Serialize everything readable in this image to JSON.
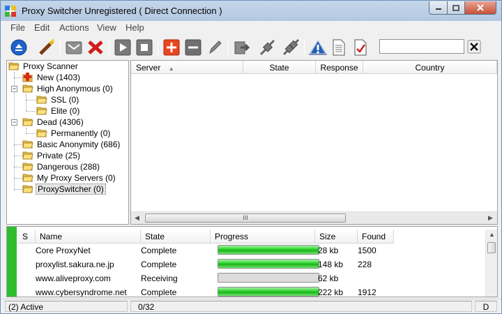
{
  "window": {
    "title": "Proxy Switcher Unregistered ( Direct Connection )"
  },
  "menu": [
    "File",
    "Edit",
    "Actions",
    "View",
    "Help"
  ],
  "toolbar": {
    "buttons": [
      "eject-icon",
      "wand-icon",
      "mail-icon",
      "delete-icon",
      "play-icon",
      "stop-icon",
      "add-icon",
      "remove-icon",
      "edit-icon",
      "export-icon",
      "connect-icon",
      "disconnect-icon",
      "warning-icon",
      "document-icon",
      "checklist-icon"
    ],
    "search_value": "",
    "clear_label": "✕"
  },
  "tree": [
    {
      "label": "Proxy Scanner",
      "level": 0
    },
    {
      "label": "New (1403)",
      "level": 1
    },
    {
      "label": "High Anonymous (0)",
      "level": 1
    },
    {
      "label": "SSL (0)",
      "level": 2
    },
    {
      "label": "Elite (0)",
      "level": 2
    },
    {
      "label": "Dead (4306)",
      "level": 1
    },
    {
      "label": "Permanently (0)",
      "level": 2
    },
    {
      "label": "Basic Anonymity (686)",
      "level": 1
    },
    {
      "label": "Private (25)",
      "level": 1
    },
    {
      "label": "Dangerous (288)",
      "level": 1
    },
    {
      "label": "My Proxy Servers (0)",
      "level": 1
    },
    {
      "label": "ProxySwitcher (0)",
      "level": 1
    }
  ],
  "server_columns": [
    "Server",
    "State",
    "Response",
    "Country"
  ],
  "scroll_grip": "III",
  "scanner_columns": [
    "S",
    "Name",
    "State",
    "Progress",
    "Size",
    "Found"
  ],
  "scanner_rows": [
    {
      "name": "Core ProxyNet",
      "state": "Complete",
      "progress": 1.0,
      "size": "28 kb",
      "found": "1500"
    },
    {
      "name": "proxylist.sakura.ne.jp",
      "state": "Complete",
      "progress": 1.0,
      "size": "148 kb",
      "found": "228"
    },
    {
      "name": "www.aliveproxy.com",
      "state": "Receiving",
      "progress": 0.0,
      "size": "62 kb",
      "found": ""
    },
    {
      "name": "www.cybersyndrome.net",
      "state": "Complete",
      "progress": 1.0,
      "size": "222 kb",
      "found": "1912"
    }
  ],
  "status": {
    "active": "(2) Active",
    "count": "0/32",
    "mode": "D"
  },
  "colors": {
    "accent_green": "#2ebd2e",
    "title_bar": "#b9cde4"
  }
}
